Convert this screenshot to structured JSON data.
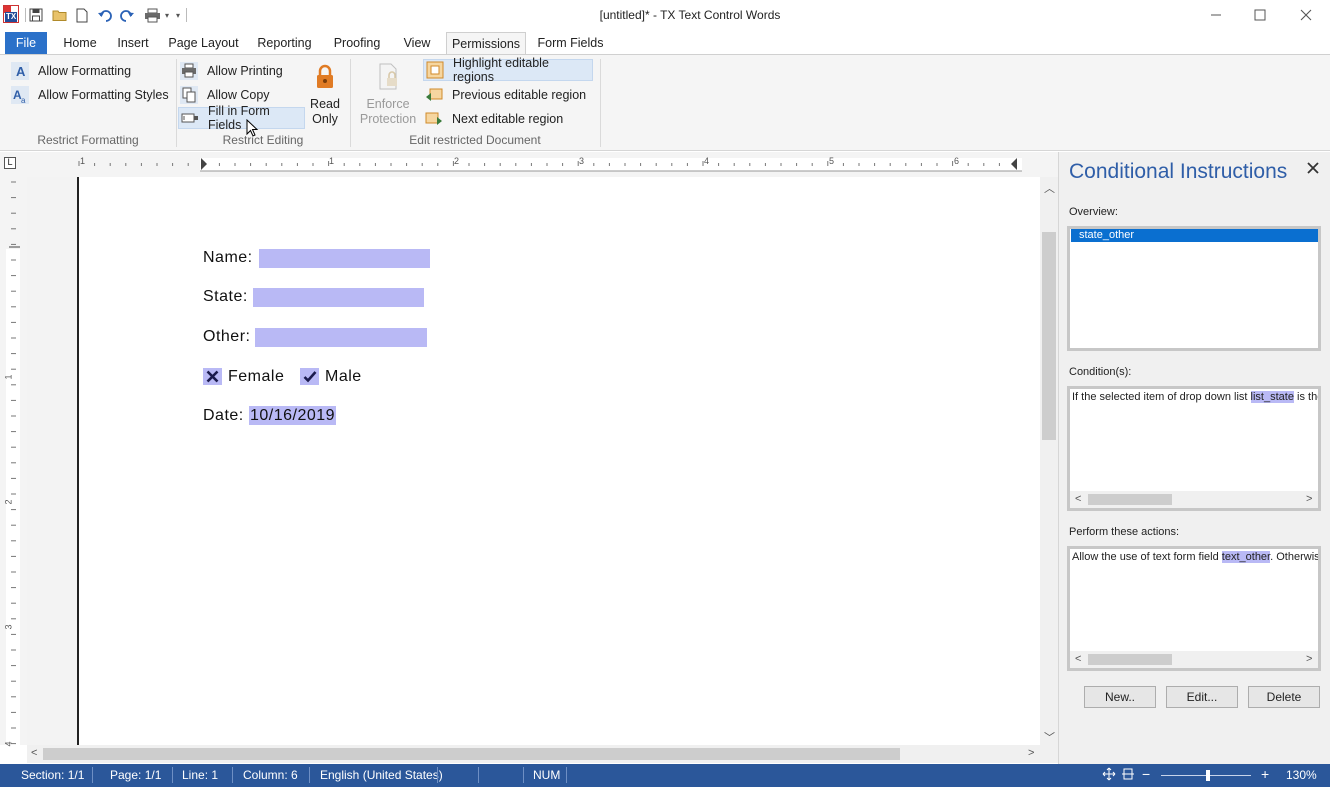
{
  "window": {
    "title": "[untitled]* - TX Text Control Words",
    "minimize_icon": "minimize-icon",
    "maximize_icon": "maximize-icon",
    "close_icon": "close-icon"
  },
  "quick_access": {
    "items": [
      "save-icon",
      "open-icon",
      "new-icon",
      "undo-icon",
      "redo-icon",
      "print-icon",
      "dropdown-icon"
    ]
  },
  "menu": {
    "tabs": [
      {
        "label": "File"
      },
      {
        "label": "Home"
      },
      {
        "label": "Insert"
      },
      {
        "label": "Page Layout"
      },
      {
        "label": "Reporting"
      },
      {
        "label": "Proofing"
      },
      {
        "label": "View"
      },
      {
        "label": "Permissions"
      },
      {
        "label": "Form Fields"
      }
    ],
    "active_tab": "Permissions"
  },
  "ribbon": {
    "restrict_formatting": {
      "allow_formatting": "Allow Formatting",
      "allow_formatting_styles": "Allow Formatting Styles",
      "group_label": "Restrict Formatting"
    },
    "restrict_editing": {
      "allow_printing": "Allow Printing",
      "allow_copy": "Allow Copy",
      "fill_in_form_fields": "Fill in Form Fields",
      "read_only_line1": "Read",
      "read_only_line2": "Only",
      "group_label": "Restrict Editing"
    },
    "edit_restricted": {
      "enforce_line1": "Enforce",
      "enforce_line2": "Protection",
      "highlight_regions": "Highlight editable regions",
      "previous_region": "Previous editable region",
      "next_region": "Next editable region",
      "group_label": "Edit restricted Document"
    }
  },
  "ruler": {
    "h_numbers": [
      "1",
      "1",
      "2",
      "3",
      "4",
      "5",
      "6"
    ],
    "v_numbers": [
      "1",
      "2",
      "3",
      "4"
    ]
  },
  "document": {
    "name_label": "Name:",
    "state_label": "State:",
    "other_label": "Other:",
    "female_label": "Female",
    "male_label": "Male",
    "date_label": "Date:",
    "date_value": "10/16/2019",
    "female_checked": true,
    "male_checked": true,
    "highlight_color": "#b9b9f5"
  },
  "side_panel": {
    "title": "Conditional Instructions",
    "overview_label": "Overview:",
    "overview_items": [
      "state_other"
    ],
    "conditions_label": "Condition(s):",
    "condition_text_pre": "If the selected item of drop down list ",
    "condition_field": "list_state",
    "condition_text_post": " is the",
    "actions_label": "Perform these actions:",
    "action_text_pre": "Allow the use of text form field ",
    "action_field": "text_other",
    "action_text_post": ". Otherwis",
    "new_button": "New..",
    "edit_button": "Edit...",
    "delete_button": "Delete"
  },
  "status_bar": {
    "section": "Section: 1/1",
    "page": "Page: 1/1",
    "line": "Line: 1",
    "column": "Column: 6",
    "language": "English (United States)",
    "num": "NUM",
    "zoom": "130%",
    "zoom_level": 0.52,
    "accent_color": "#2b579a"
  }
}
